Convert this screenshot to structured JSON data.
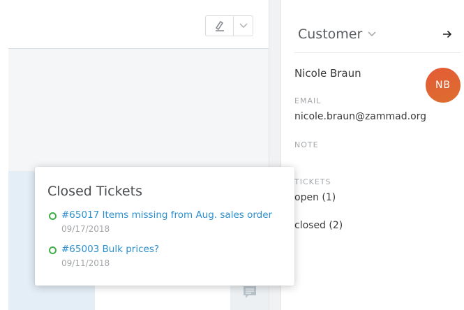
{
  "sidebar": {
    "title": "Customer",
    "customer_name": "Nicole Braun",
    "avatar_initials": "NB",
    "email_label": "EMAIL",
    "email": "nicole.braun@zammad.org",
    "note_label": "NOTE",
    "tickets_label": "TICKETS",
    "open_tickets": "open (1)",
    "closed_tickets": "closed (2)"
  },
  "toolbar": {
    "main_icon": "highlighter-icon",
    "dropdown_icon": "chevron-down-icon"
  },
  "popover": {
    "title": "Closed Tickets",
    "tickets": [
      {
        "label": "#65017 Items missing from Aug. sales order",
        "date": "09/17/2018"
      },
      {
        "label": "#65003 Bulk prices?",
        "date": "09/11/2018"
      }
    ]
  },
  "colors": {
    "avatar": "#e35b36",
    "link": "#2c8fcf",
    "status_closed": "#3fae49"
  }
}
